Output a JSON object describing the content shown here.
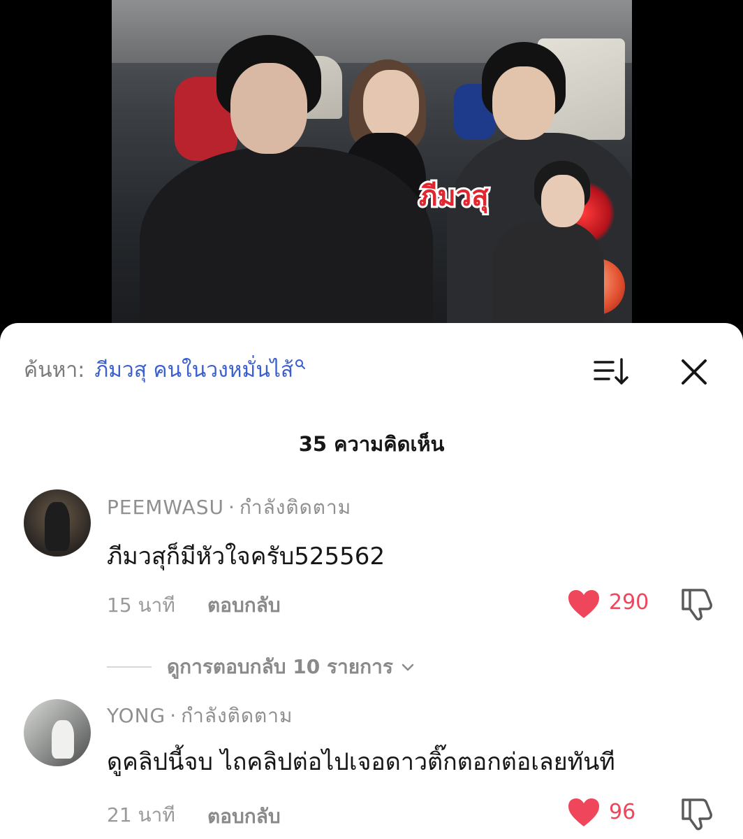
{
  "video": {
    "overlay_text": "ภีมวสุ"
  },
  "search": {
    "prefix": "ค้นหา:",
    "term": "ภีมวสุ คนในวงหมั่นไส้",
    "icon": "search-icon"
  },
  "header": {
    "sort_icon": "sort-icon",
    "close_icon": "close-icon"
  },
  "comments_count": "35 ความคิดเห็น",
  "comments": [
    {
      "username": "PEEMWASU",
      "separator": "·",
      "follow_status": "กำลังติดตาม",
      "text": "ภีมวสุก็มีหัวใจครับ525562",
      "time": "15 นาที",
      "reply_label": "ตอบกลับ",
      "likes": "290",
      "view_replies": "ดูการตอบกลับ 10 รายการ"
    },
    {
      "username": "YONG",
      "separator": "·",
      "follow_status": "กำลังติดตาม",
      "text": "ดูคลิปนี้จบ ไถคลิปต่อไปเจอดาวติ๊กตอกต่อเลยทันที",
      "time": "21 นาที",
      "reply_label": "ตอบกลับ",
      "likes": "96"
    }
  ],
  "colors": {
    "accent_blue": "#3a5fcf",
    "like_red": "#f0465b"
  }
}
